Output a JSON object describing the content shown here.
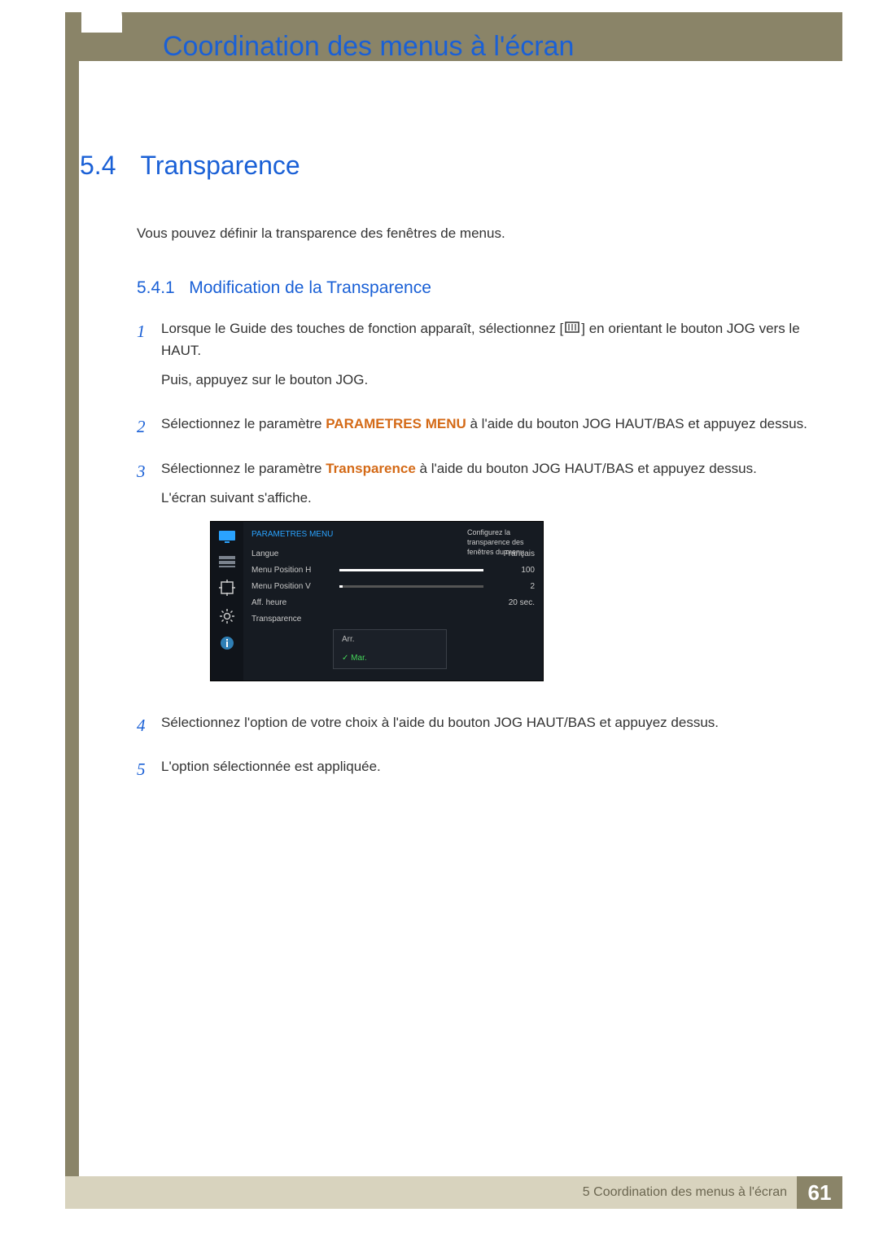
{
  "chapter_title": "Coordination des menus à l'écran",
  "section": {
    "number": "5.4",
    "title": "Transparence"
  },
  "intro": "Vous pouvez définir la transparence des fenêtres de menus.",
  "subsection": {
    "number": "5.4.1",
    "title": "Modification de la Transparence"
  },
  "steps": {
    "s1a": "Lorsque le Guide des touches de fonction apparaît, sélectionnez [",
    "s1b": "] en orientant le bouton JOG vers le HAUT.",
    "s1c": "Puis, appuyez sur le bouton JOG.",
    "s2a": "Sélectionnez le paramètre ",
    "s2_bold": "PARAMETRES MENU",
    "s2b": " à l'aide du bouton JOG HAUT/BAS et appuyez dessus.",
    "s3a": "Sélectionnez le paramètre ",
    "s3_bold": "Transparence",
    "s3b": " à l'aide du bouton JOG HAUT/BAS et appuyez dessus.",
    "s3c": "L'écran suivant s'affiche.",
    "s4": "Sélectionnez l'option de votre choix à l'aide du bouton JOG HAUT/BAS et appuyez dessus.",
    "s5": "L'option sélectionnée est appliquée."
  },
  "step_numbers": {
    "n1": "1",
    "n2": "2",
    "n3": "3",
    "n4": "4",
    "n5": "5"
  },
  "osd": {
    "header": "PARAMETRES MENU",
    "rows": {
      "langue": {
        "label": "Langue",
        "value": "Français"
      },
      "posh": {
        "label": "Menu Position H",
        "value": "100",
        "fill": 100
      },
      "posv": {
        "label": "Menu Position V",
        "value": "2",
        "fill": 2
      },
      "aff": {
        "label": "Aff. heure",
        "value": "20 sec."
      },
      "transp": {
        "label": "Transparence"
      }
    },
    "dropdown": {
      "opt_off": "Arr.",
      "opt_on": "Mar."
    },
    "help": "Configurez la transparence des fenêtres du menu."
  },
  "footer": {
    "text": "5 Coordination des menus à l'écran",
    "page": "61"
  }
}
